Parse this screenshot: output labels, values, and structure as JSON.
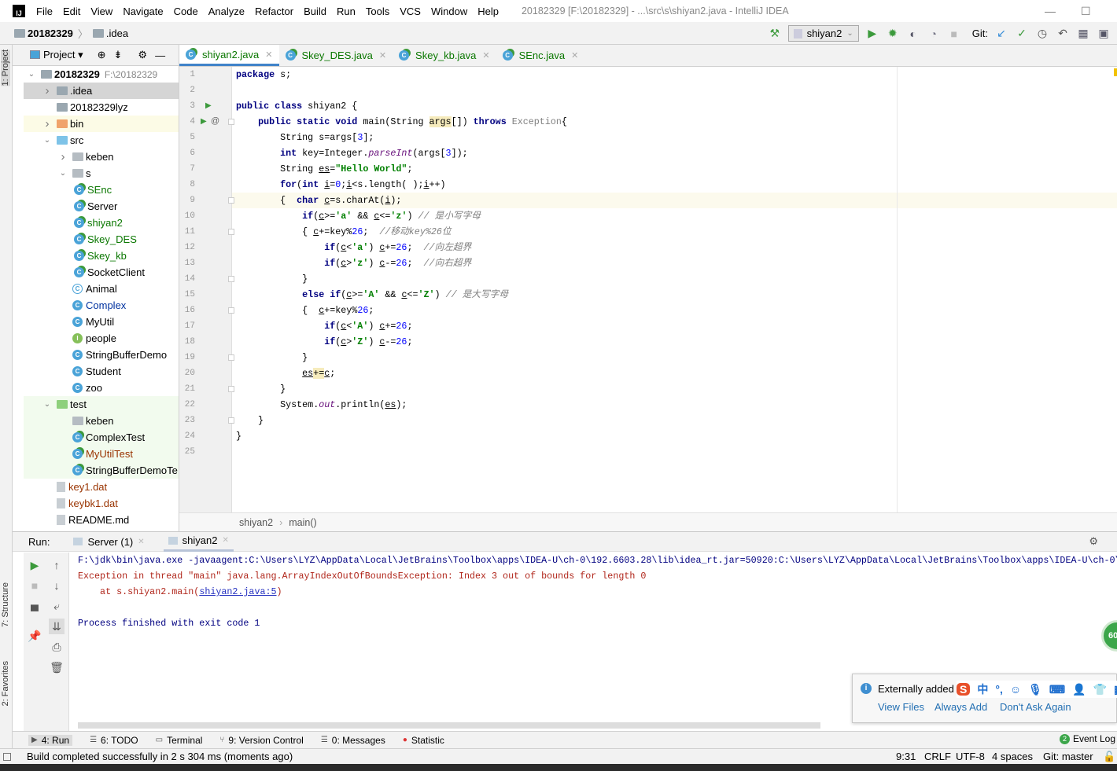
{
  "menubar": {
    "items": [
      "File",
      "Edit",
      "View",
      "Navigate",
      "Code",
      "Analyze",
      "Refactor",
      "Build",
      "Run",
      "Tools",
      "VCS",
      "Window",
      "Help"
    ],
    "title": "20182329 [F:\\20182329] - ...\\src\\s\\shiyan2.java - IntelliJ IDEA"
  },
  "navbar": {
    "breadcrumb": [
      "20182329",
      ".idea"
    ],
    "run_config": "shiyan2",
    "git_label": "Git:"
  },
  "leftstripe": {
    "project": "1: Project",
    "structure": "7: Structure",
    "favorites": "2: Favorites"
  },
  "project": {
    "header": "Project",
    "tree": [
      {
        "label": "20182329",
        "path": "F:\\20182329",
        "level": 0,
        "arrow": "down",
        "icon": "folder-module",
        "bold": true
      },
      {
        "label": ".idea",
        "level": 1,
        "arrow": "right",
        "icon": "folder",
        "selected": true
      },
      {
        "label": "20182329lyz",
        "level": 1,
        "arrow": "",
        "icon": "folder"
      },
      {
        "label": "bin",
        "level": 1,
        "arrow": "right",
        "icon": "folder-excluded",
        "bg": "#fcfbe6"
      },
      {
        "label": "src",
        "level": 1,
        "arrow": "down",
        "icon": "folder-source"
      },
      {
        "label": "keben",
        "level": 2,
        "arrow": "right",
        "icon": "package"
      },
      {
        "label": "s",
        "level": 2,
        "arrow": "down",
        "icon": "package"
      },
      {
        "label": "SEnc",
        "level": 3,
        "icon": "class-runnable",
        "color": "#0a7700"
      },
      {
        "label": "Server",
        "level": 3,
        "icon": "class-runnable"
      },
      {
        "label": "shiyan2",
        "level": 3,
        "icon": "class-runnable",
        "color": "#0a7700"
      },
      {
        "label": "Skey_DES",
        "level": 3,
        "icon": "class-runnable",
        "color": "#0a7700"
      },
      {
        "label": "Skey_kb",
        "level": 3,
        "icon": "class-runnable",
        "color": "#0a7700"
      },
      {
        "label": "SocketClient",
        "level": 3,
        "icon": "class-runnable"
      },
      {
        "label": "Animal",
        "level": 2,
        "icon": "abstract-class"
      },
      {
        "label": "Complex",
        "level": 2,
        "icon": "class",
        "color": "#0032a0"
      },
      {
        "label": "MyUtil",
        "level": 2,
        "icon": "class"
      },
      {
        "label": "people",
        "level": 2,
        "icon": "interface"
      },
      {
        "label": "StringBufferDemo",
        "level": 2,
        "icon": "class"
      },
      {
        "label": "Student",
        "level": 2,
        "icon": "class"
      },
      {
        "label": "zoo",
        "level": 2,
        "icon": "class"
      },
      {
        "label": "test",
        "level": 1,
        "arrow": "down",
        "icon": "folder-test",
        "bg": "#f2fbee"
      },
      {
        "label": "keben",
        "level": 2,
        "icon": "package",
        "bg": "#f2fbee"
      },
      {
        "label": "ComplexTest",
        "level": 2,
        "icon": "class-runnable",
        "bg": "#f2fbee"
      },
      {
        "label": "MyUtilTest",
        "level": 2,
        "icon": "class-runnable",
        "color": "#993300",
        "bg": "#f2fbee"
      },
      {
        "label": "StringBufferDemoTe",
        "level": 2,
        "icon": "class-runnable",
        "bg": "#f2fbee"
      },
      {
        "label": "key1.dat",
        "level": 1,
        "icon": "file",
        "color": "#993300"
      },
      {
        "label": "keybk1.dat",
        "level": 1,
        "icon": "file",
        "color": "#993300"
      },
      {
        "label": "README.md",
        "level": 1,
        "icon": "markdown-file"
      }
    ]
  },
  "tabs": [
    {
      "label": "shiyan2.java",
      "active": true
    },
    {
      "label": "Skey_DES.java"
    },
    {
      "label": "Skey_kb.java"
    },
    {
      "label": "SEnc.java"
    }
  ],
  "editor": {
    "current_line": 9,
    "lines": [
      [
        [
          "k",
          "package"
        ],
        [
          "p",
          " s;"
        ]
      ],
      [],
      [
        [
          "k",
          "public class"
        ],
        [
          "p",
          " shiyan2 {"
        ]
      ],
      [
        [
          "p",
          "    "
        ],
        [
          "k",
          "public static void"
        ],
        [
          "p",
          " main(String "
        ],
        [
          "h",
          "args"
        ],
        [
          "p",
          "[]) "
        ],
        [
          "k",
          "throws"
        ],
        [
          "p",
          " "
        ],
        [
          "g",
          "Exception"
        ],
        [
          "p",
          "{"
        ]
      ],
      [
        [
          "p",
          "        String s=args["
        ],
        [
          "n",
          "3"
        ],
        [
          "p",
          "];"
        ]
      ],
      [
        [
          "p",
          "        "
        ],
        [
          "k",
          "int"
        ],
        [
          "p",
          " key=Integer."
        ],
        [
          "i",
          "parseInt"
        ],
        [
          "p",
          "(args["
        ],
        [
          "n",
          "3"
        ],
        [
          "p",
          "]);"
        ]
      ],
      [
        [
          "p",
          "        String "
        ],
        [
          "u",
          "es"
        ],
        [
          "p",
          "="
        ],
        [
          "s",
          "\"Hello World\""
        ],
        [
          "p",
          ";"
        ]
      ],
      [
        [
          "p",
          "        "
        ],
        [
          "k",
          "for"
        ],
        [
          "p",
          "("
        ],
        [
          "k",
          "int"
        ],
        [
          "p",
          " "
        ],
        [
          "u",
          "i"
        ],
        [
          "p",
          "="
        ],
        [
          "n",
          "0"
        ],
        [
          "p",
          ";"
        ],
        [
          "u",
          "i"
        ],
        [
          "p",
          "<s.length( );"
        ],
        [
          "u",
          "i"
        ],
        [
          "p",
          "++)"
        ]
      ],
      [
        [
          "p",
          "        {  "
        ],
        [
          "k",
          "char"
        ],
        [
          "p",
          " "
        ],
        [
          "u",
          "c"
        ],
        [
          "p",
          "=s.charAt("
        ],
        [
          "u",
          "i"
        ],
        [
          "p",
          ");"
        ]
      ],
      [
        [
          "p",
          "            "
        ],
        [
          "k",
          "if"
        ],
        [
          "p",
          "("
        ],
        [
          "u",
          "c"
        ],
        [
          "p",
          ">="
        ],
        [
          "s",
          "'a'"
        ],
        [
          "p",
          " && "
        ],
        [
          "u",
          "c"
        ],
        [
          "p",
          "<="
        ],
        [
          "s",
          "'z'"
        ],
        [
          "p",
          ") "
        ],
        [
          "c",
          "// 是小写字母"
        ]
      ],
      [
        [
          "p",
          "            { "
        ],
        [
          "u",
          "c"
        ],
        [
          "p",
          "+=key%"
        ],
        [
          "n",
          "26"
        ],
        [
          "p",
          ";  "
        ],
        [
          "c",
          "//移动key%26位"
        ]
      ],
      [
        [
          "p",
          "                "
        ],
        [
          "k",
          "if"
        ],
        [
          "p",
          "("
        ],
        [
          "u",
          "c"
        ],
        [
          "p",
          "<"
        ],
        [
          "s",
          "'a'"
        ],
        [
          "p",
          ") "
        ],
        [
          "u",
          "c"
        ],
        [
          "p",
          "+="
        ],
        [
          "n",
          "26"
        ],
        [
          "p",
          ";  "
        ],
        [
          "c",
          "//向左超界"
        ]
      ],
      [
        [
          "p",
          "                "
        ],
        [
          "k",
          "if"
        ],
        [
          "p",
          "("
        ],
        [
          "u",
          "c"
        ],
        [
          "p",
          ">"
        ],
        [
          "s",
          "'z'"
        ],
        [
          "p",
          ") "
        ],
        [
          "u",
          "c"
        ],
        [
          "p",
          "-="
        ],
        [
          "n",
          "26"
        ],
        [
          "p",
          ";  "
        ],
        [
          "c",
          "//向右超界"
        ]
      ],
      [
        [
          "p",
          "            }"
        ]
      ],
      [
        [
          "p",
          "            "
        ],
        [
          "k",
          "else if"
        ],
        [
          "p",
          "("
        ],
        [
          "u",
          "c"
        ],
        [
          "p",
          ">="
        ],
        [
          "s",
          "'A'"
        ],
        [
          "p",
          " && "
        ],
        [
          "u",
          "c"
        ],
        [
          "p",
          "<="
        ],
        [
          "s",
          "'Z'"
        ],
        [
          "p",
          ") "
        ],
        [
          "c",
          "// 是大写字母"
        ]
      ],
      [
        [
          "p",
          "            {  "
        ],
        [
          "u",
          "c"
        ],
        [
          "p",
          "+=key%"
        ],
        [
          "n",
          "26"
        ],
        [
          "p",
          ";"
        ]
      ],
      [
        [
          "p",
          "                "
        ],
        [
          "k",
          "if"
        ],
        [
          "p",
          "("
        ],
        [
          "u",
          "c"
        ],
        [
          "p",
          "<"
        ],
        [
          "s",
          "'A'"
        ],
        [
          "p",
          ") "
        ],
        [
          "u",
          "c"
        ],
        [
          "p",
          "+="
        ],
        [
          "n",
          "26"
        ],
        [
          "p",
          ";"
        ]
      ],
      [
        [
          "p",
          "                "
        ],
        [
          "k",
          "if"
        ],
        [
          "p",
          "("
        ],
        [
          "u",
          "c"
        ],
        [
          "p",
          ">"
        ],
        [
          "s",
          "'Z'"
        ],
        [
          "p",
          ") "
        ],
        [
          "u",
          "c"
        ],
        [
          "p",
          "-="
        ],
        [
          "n",
          "26"
        ],
        [
          "p",
          ";"
        ]
      ],
      [
        [
          "p",
          "            }"
        ]
      ],
      [
        [
          "p",
          "            "
        ],
        [
          "u",
          "es"
        ],
        [
          "h",
          "+="
        ],
        [
          "u",
          "c"
        ],
        [
          "p",
          ";"
        ]
      ],
      [
        [
          "p",
          "        }"
        ]
      ],
      [
        [
          "p",
          "        System."
        ],
        [
          "i",
          "out"
        ],
        [
          "p",
          ".println("
        ],
        [
          "u",
          "es"
        ],
        [
          "p",
          ");"
        ]
      ],
      [
        [
          "p",
          "    }"
        ]
      ],
      [
        [
          "p",
          "}"
        ]
      ],
      []
    ]
  },
  "breadcrumb": [
    "shiyan2",
    "main()"
  ],
  "run": {
    "label": "Run:",
    "tabs": [
      {
        "label": "Server (1)"
      },
      {
        "label": "shiyan2",
        "active": true
      }
    ],
    "console": [
      {
        "text": "F:\\jdk\\bin\\java.exe -javaagent:C:\\Users\\LYZ\\AppData\\Local\\JetBrains\\Toolbox\\apps\\IDEA-U\\ch-0\\192.6603.28\\lib\\idea_rt.jar=50920:C:\\Users\\LYZ\\AppData\\Local\\JetBrains\\Toolbox\\apps\\IDEA-U\\ch-0\\",
        "color": "#000080"
      },
      {
        "text": "Exception in thread \"main\" java.lang.ArrayIndexOutOfBoundsException: Index 3 out of bounds for length 0",
        "color": "#b0261b"
      },
      {
        "text": "    at s.shiyan2.main(",
        "link": "shiyan2.java:5",
        "after": ")",
        "color": "#b0261b"
      },
      {
        "text": "",
        "color": "#000"
      },
      {
        "text": "Process finished with exit code 1",
        "color": "#000080"
      }
    ]
  },
  "toolwindows": [
    {
      "label": "4: Run",
      "active": true
    },
    {
      "label": "6: TODO"
    },
    {
      "label": "Terminal"
    },
    {
      "label": "9: Version Control"
    },
    {
      "label": "0: Messages"
    },
    {
      "label": "Statistic"
    }
  ],
  "event_log": {
    "count": "2",
    "label": "Event Log"
  },
  "notification": {
    "text": "Externally added",
    "actions": [
      "View Files",
      "Always Add",
      "Don't Ask Again"
    ]
  },
  "status": {
    "message": "Build completed successfully in 2 s 304 ms (moments ago)",
    "position": "9:31",
    "line_sep": "CRLF",
    "encoding": "UTF-8",
    "indent": "4 spaces",
    "git": "Git: master"
  },
  "badge": "60"
}
